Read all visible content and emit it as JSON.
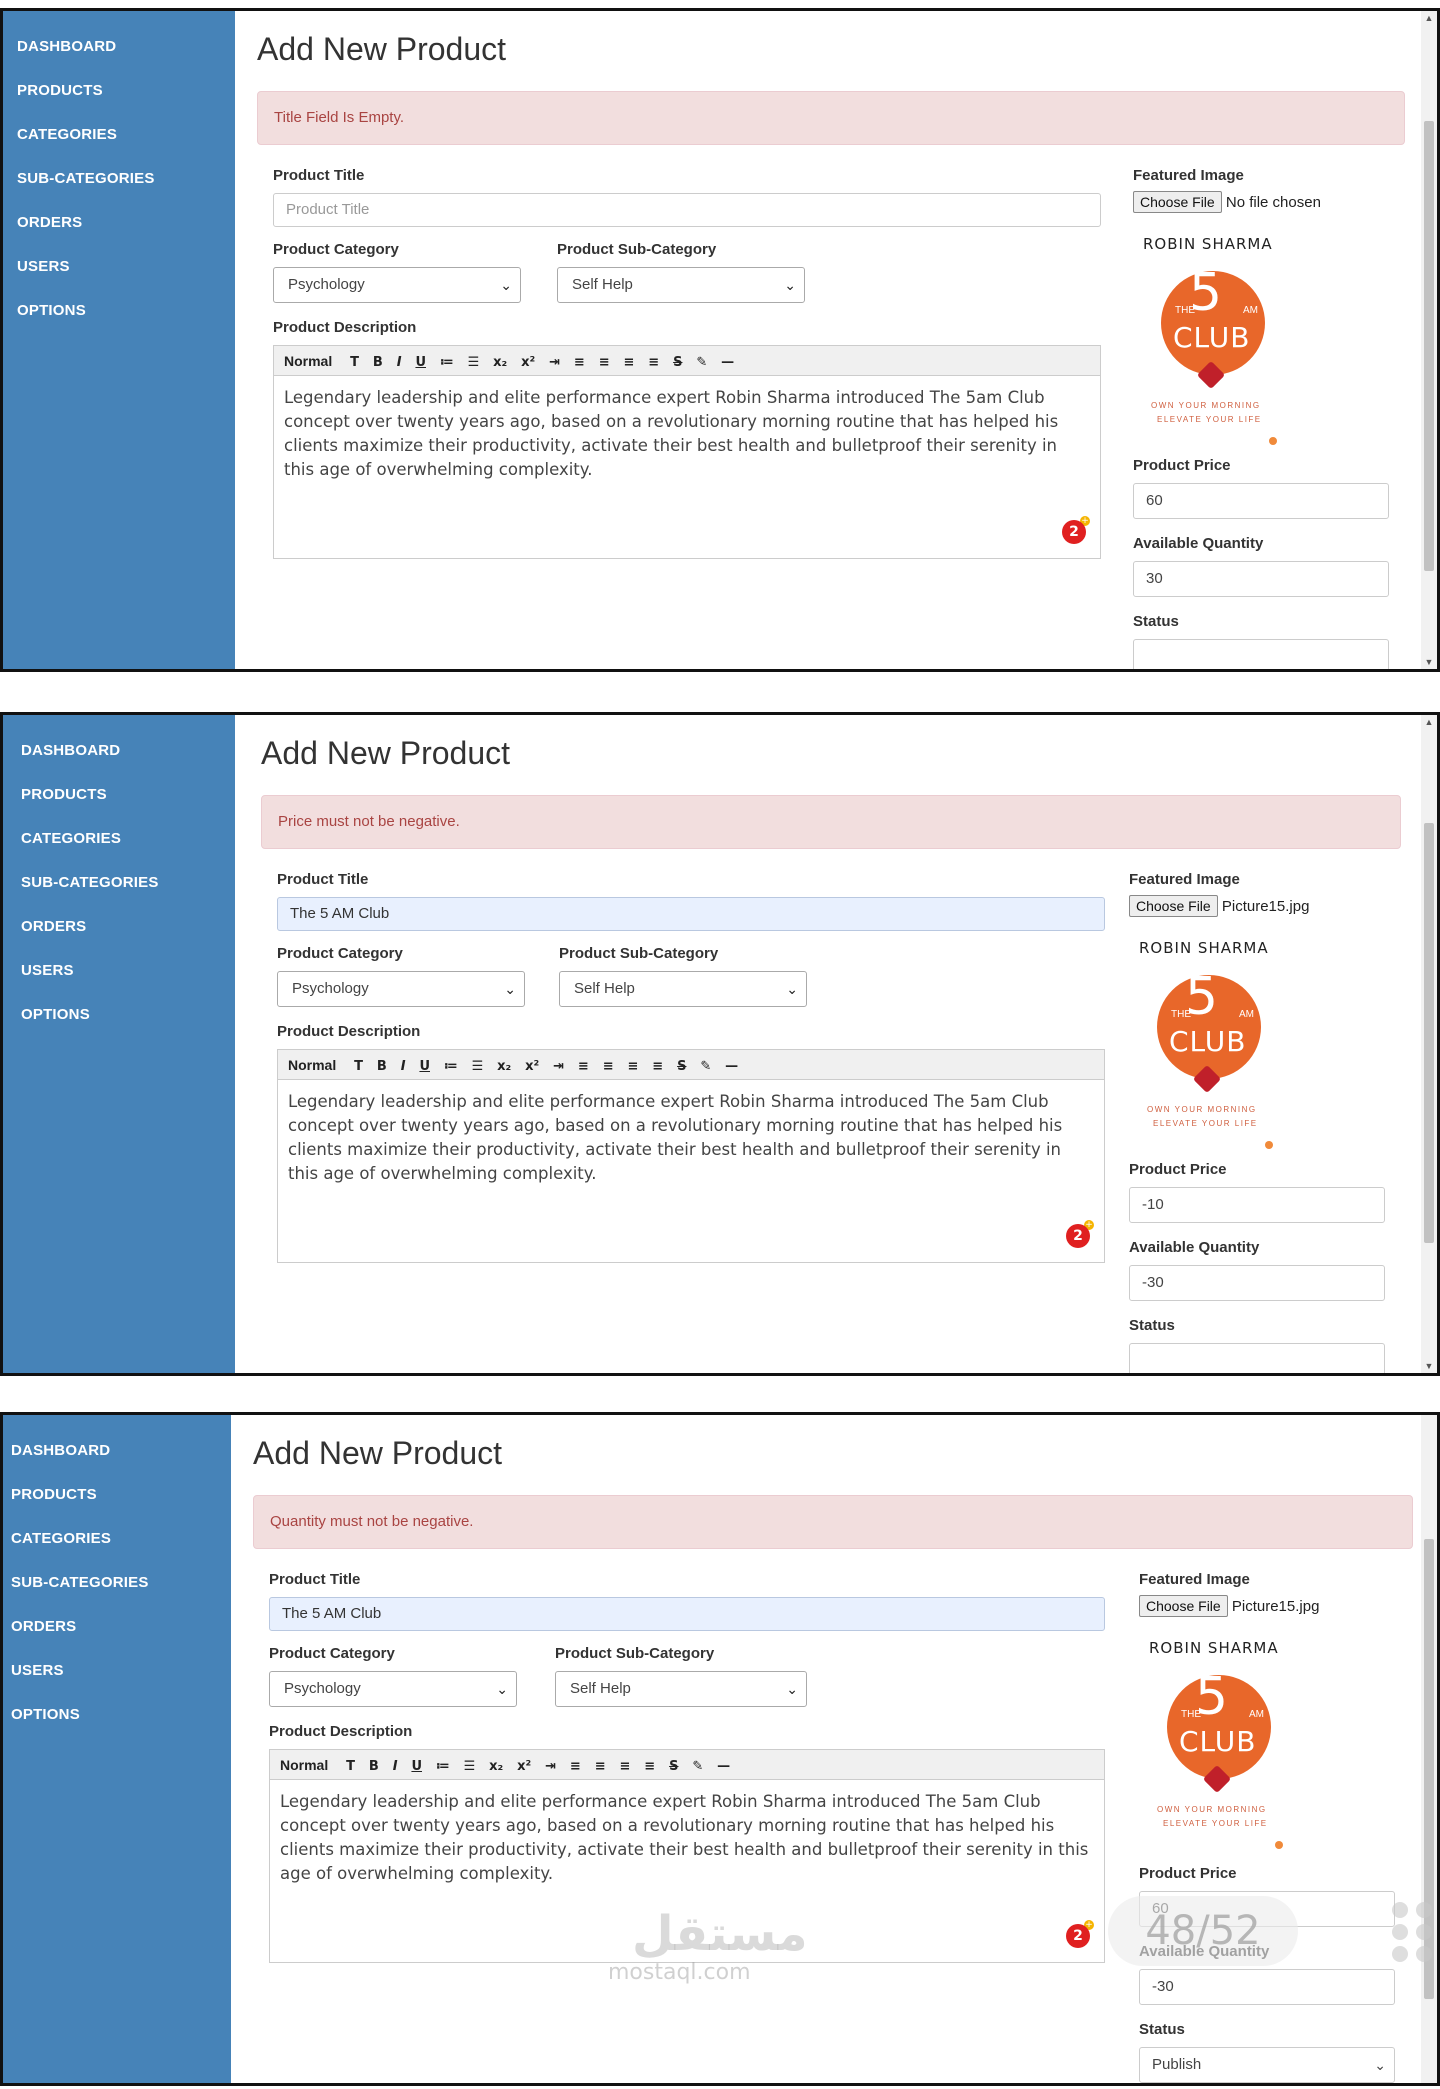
{
  "nav": [
    "DASHBOARD",
    "PRODUCTS",
    "CATEGORIES",
    "SUB-CATEGORIES",
    "ORDERS",
    "USERS",
    "OPTIONS"
  ],
  "labels": {
    "page_title": "Add New Product",
    "product_title": "Product Title",
    "product_category": "Product Category",
    "product_sub_category": "Product Sub-Category",
    "product_description": "Product Description",
    "featured_image": "Featured Image",
    "choose_file": "Choose File",
    "product_price": "Product Price",
    "available_quantity": "Available Quantity",
    "status": "Status",
    "title_placeholder": "Product Title"
  },
  "toolbar": {
    "format": "Normal",
    "buttons": [
      "T",
      "B",
      "I",
      "U",
      "≔",
      "☰",
      "x₂",
      "x²",
      "⇥",
      "≡",
      "≡",
      "≡",
      "≡",
      "S",
      "✎",
      "—"
    ]
  },
  "description": "Legendary leadership and elite performance expert Robin Sharma introduced The 5am Club concept over twenty years ago, based on a revolutionary morning routine that has helped his clients maximize their productivity, activate their best health and bulletproof their serenity in this age of overwhelming complexity.",
  "badge_count": "2",
  "cover": {
    "author": "ROBIN SHARMA",
    "number": "5",
    "the": "THE",
    "am": "AM",
    "club": "CLUB",
    "line1": "OWN YOUR MORNING",
    "line2": "ELEVATE YOUR LIFE"
  },
  "panels": [
    {
      "alert": "Title Field Is Empty.",
      "title_value": "",
      "category": "Psychology",
      "sub_category": "Self Help",
      "file_name": "No file chosen",
      "price": "60",
      "quantity": "30",
      "status": ""
    },
    {
      "alert": "Price must not be negative.",
      "title_value": "The 5 AM Club",
      "category": "Psychology",
      "sub_category": "Self Help",
      "file_name": "Picture15.jpg",
      "price": "-10",
      "quantity": "-30",
      "status": ""
    },
    {
      "alert": "Quantity must not be negative.",
      "title_value": "The 5 AM Club",
      "category": "Psychology",
      "sub_category": "Self Help",
      "file_name": "Picture15.jpg",
      "price": "60",
      "quantity": "-30",
      "status": "Publish"
    }
  ],
  "overlay": {
    "page_counter": "48/52",
    "watermark_arabic": "مستقل",
    "watermark_latin": "mostaql.com"
  }
}
